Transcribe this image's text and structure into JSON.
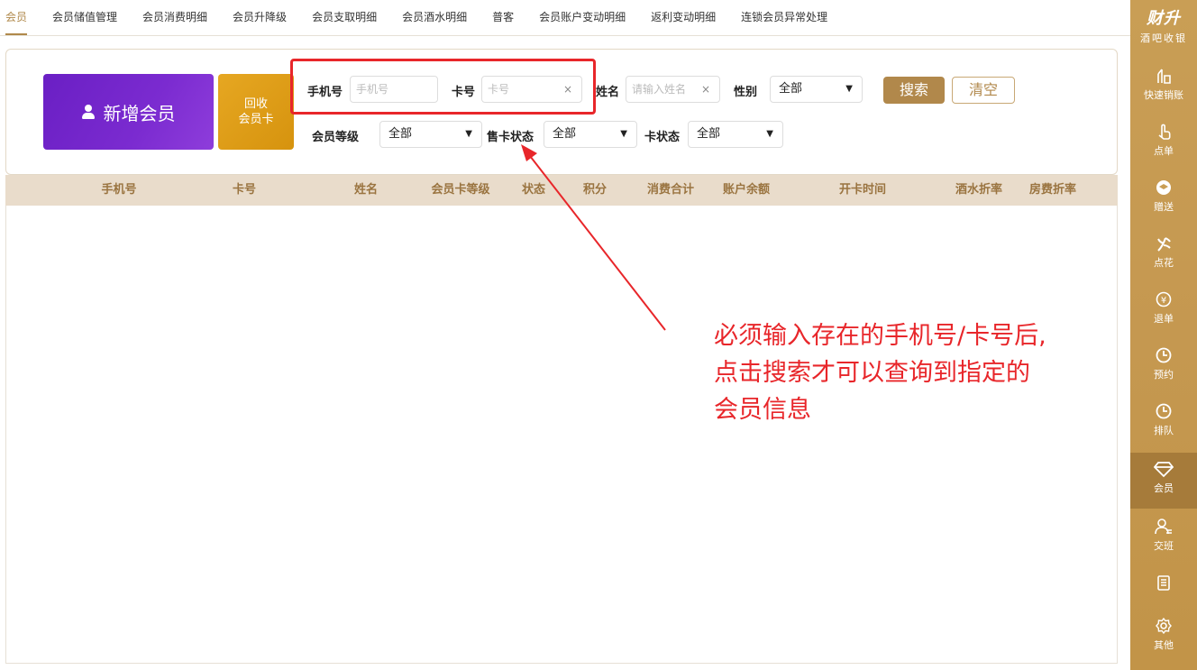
{
  "tabs": [
    "会员",
    "会员储值管理",
    "会员消费明细",
    "会员升降级",
    "会员支取明细",
    "会员酒水明细",
    "普客",
    "会员账户变动明细",
    "返利变动明细",
    "连锁会员异常处理"
  ],
  "active_tab": "会员",
  "search": {
    "add_member": "新增会员",
    "recycle_line1": "回收",
    "recycle_line2": "会员卡",
    "phone_label": "手机号",
    "phone_placeholder": "手机号",
    "card_label": "卡号",
    "card_placeholder": "卡号",
    "name_label": "姓名",
    "name_placeholder": "请输入姓名",
    "gender_label": "性别",
    "gender_value": "全部",
    "level_label": "会员等级",
    "level_value": "全部",
    "sale_status_label": "售卡状态",
    "sale_status_value": "全部",
    "card_status_label": "卡状态",
    "card_status_value": "全部",
    "search_btn": "搜索",
    "clear_btn": "清空",
    "clear_x": "×"
  },
  "table": {
    "columns": [
      "手机号",
      "卡号",
      "姓名",
      "会员卡等级",
      "状态",
      "积分",
      "消费合计",
      "账户余额",
      "开卡时间",
      "酒水折率",
      "房费折率"
    ]
  },
  "annotation": {
    "line1": "必须输入存在的手机号/卡号后,",
    "line2": "点击搜索才可以查询到指定的",
    "line3": "会员信息"
  },
  "sidebar": {
    "brand": "财升",
    "brand_sub": "酒吧收银",
    "items": [
      {
        "label": "快速销账",
        "icon": "quick-checkout-icon"
      },
      {
        "label": "点单",
        "icon": "tap-order-icon"
      },
      {
        "label": "赠送",
        "icon": "gift-icon"
      },
      {
        "label": "点花",
        "icon": "flower-icon"
      },
      {
        "label": "退单",
        "icon": "refund-icon"
      },
      {
        "label": "预约",
        "icon": "clock-icon"
      },
      {
        "label": "排队",
        "icon": "clock-icon"
      },
      {
        "label": "会员",
        "icon": "diamond-icon"
      },
      {
        "label": "交班",
        "icon": "handover-icon"
      },
      {
        "label": "",
        "icon": "report-icon"
      },
      {
        "label": "其他",
        "icon": "gear-icon"
      }
    ],
    "active": "会员"
  },
  "colors": {
    "accent": "#b1884b",
    "sidebar": "#c99e55",
    "annotation": "#e8262a",
    "add_member_bg": "#7027c9",
    "recycle_bg": "#e0a01a"
  }
}
